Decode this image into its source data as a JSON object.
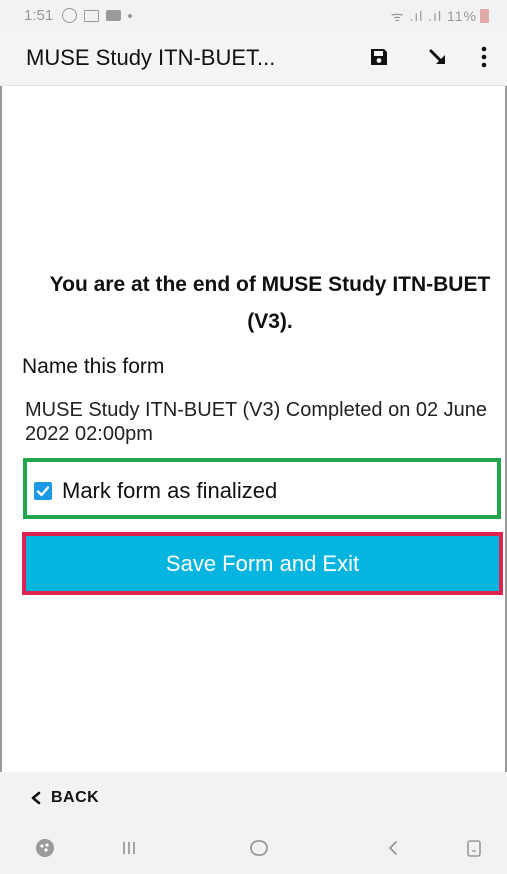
{
  "status_bar": {
    "time": "1:51",
    "right_text": "ᯤ .ıl .ıl 11%",
    "battery_color": "#e3a9a9"
  },
  "app_bar": {
    "title": "MUSE Study ITN-BUET...",
    "icons": [
      "save-icon",
      "jump-arrow-icon",
      "more-vert-icon"
    ]
  },
  "main": {
    "end_message": "You are at the end of MUSE Study ITN-BUET (V3).",
    "name_label": "Name this form",
    "form_name": "MUSE Study ITN-BUET (V3) Completed on 02 June 2022 02:00pm",
    "finalize_checked": true,
    "finalize_label": "Mark form as finalized",
    "save_button_label": "Save Form and Exit"
  },
  "footer": {
    "back_label": "BACK"
  },
  "colors": {
    "accent": "#06b4e0",
    "checkbox": "#1a9ae6",
    "highlight_green": "#22a64e",
    "highlight_red": "#e0234e"
  }
}
